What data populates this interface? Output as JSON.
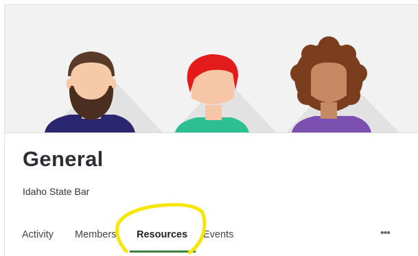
{
  "group": {
    "name": "General",
    "organization": "Idaho State Bar"
  },
  "tabs": [
    {
      "label": "Activity",
      "active": false
    },
    {
      "label": "Members",
      "active": false
    },
    {
      "label": "Resources",
      "active": true
    },
    {
      "label": "Events",
      "active": false
    }
  ],
  "more_menu": {
    "label": "•••"
  },
  "banner": {
    "icon": "group-avatars-illustration"
  },
  "colors": {
    "active_tab_underline": "#3d7f3a",
    "highlight_scribble": "#f7e600"
  }
}
